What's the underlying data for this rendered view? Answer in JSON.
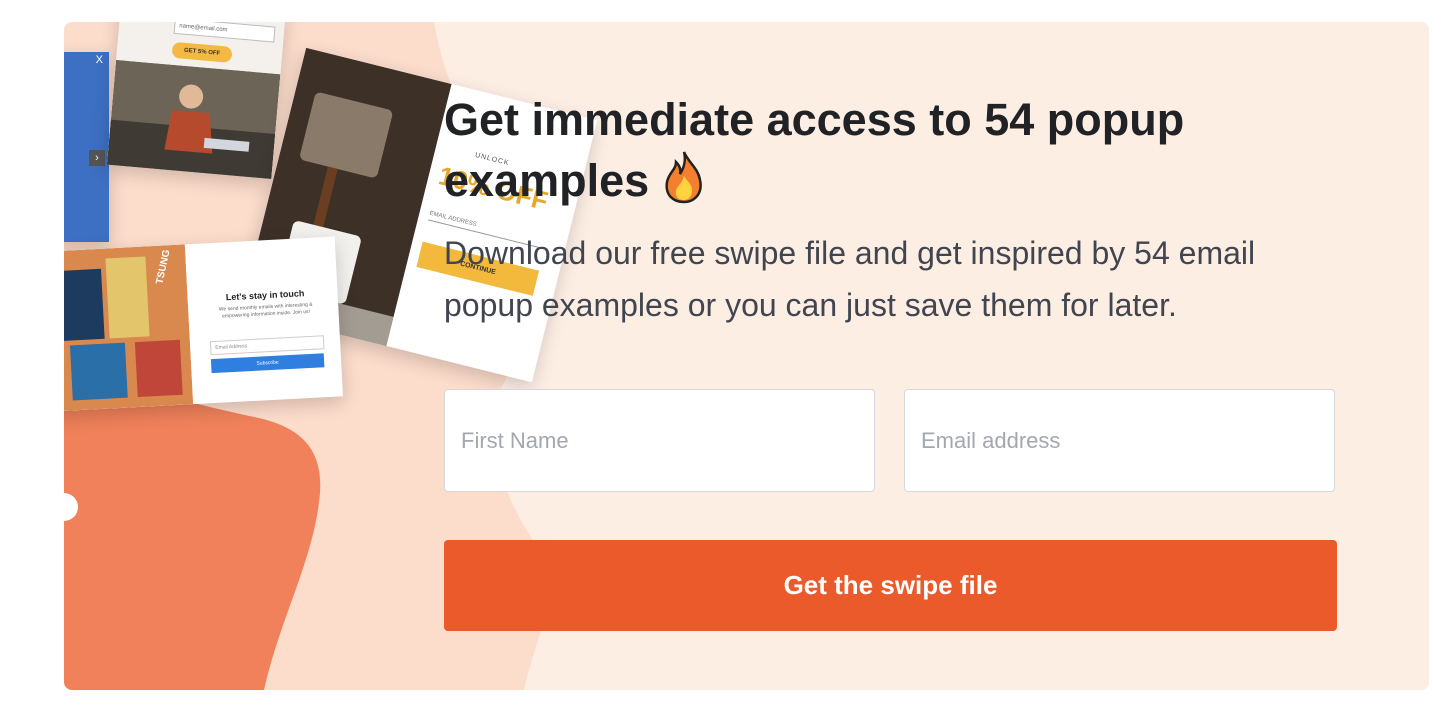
{
  "headline": {
    "text": "Get immediate access to 54 popup examples",
    "emoji_icon": "fire-icon"
  },
  "subtitle": "Download our free swipe file and get inspired by 54 email popup examples or you can just save them for later.",
  "form": {
    "first_name_placeholder": "First Name",
    "email_placeholder": "Email address",
    "submit_label": "Get the swipe file"
  },
  "collage": {
    "popup_a": {
      "email_text": "name@email.com",
      "button_label": "GET 5% OFF"
    },
    "popup_b": {
      "close_label": "X"
    },
    "popup_c": {
      "unlock_text": "UNLOCK",
      "discount_text": "10% OFF",
      "field_text": "EMAIL ADDRESS",
      "button_label": "CONTINUE"
    },
    "popup_d": {
      "title": "Let's stay in touch",
      "body": "We send monthly emails with interesting & empowering information inside. Join us!",
      "field_text": "Email Address",
      "button_label": "Subscribe",
      "brand_text": "TSUNG"
    }
  },
  "colors": {
    "card_bg": "#fdeee4",
    "accent": "#ea5a2a",
    "blob": "#f0815a",
    "heading": "#212226",
    "body": "#41454f"
  }
}
